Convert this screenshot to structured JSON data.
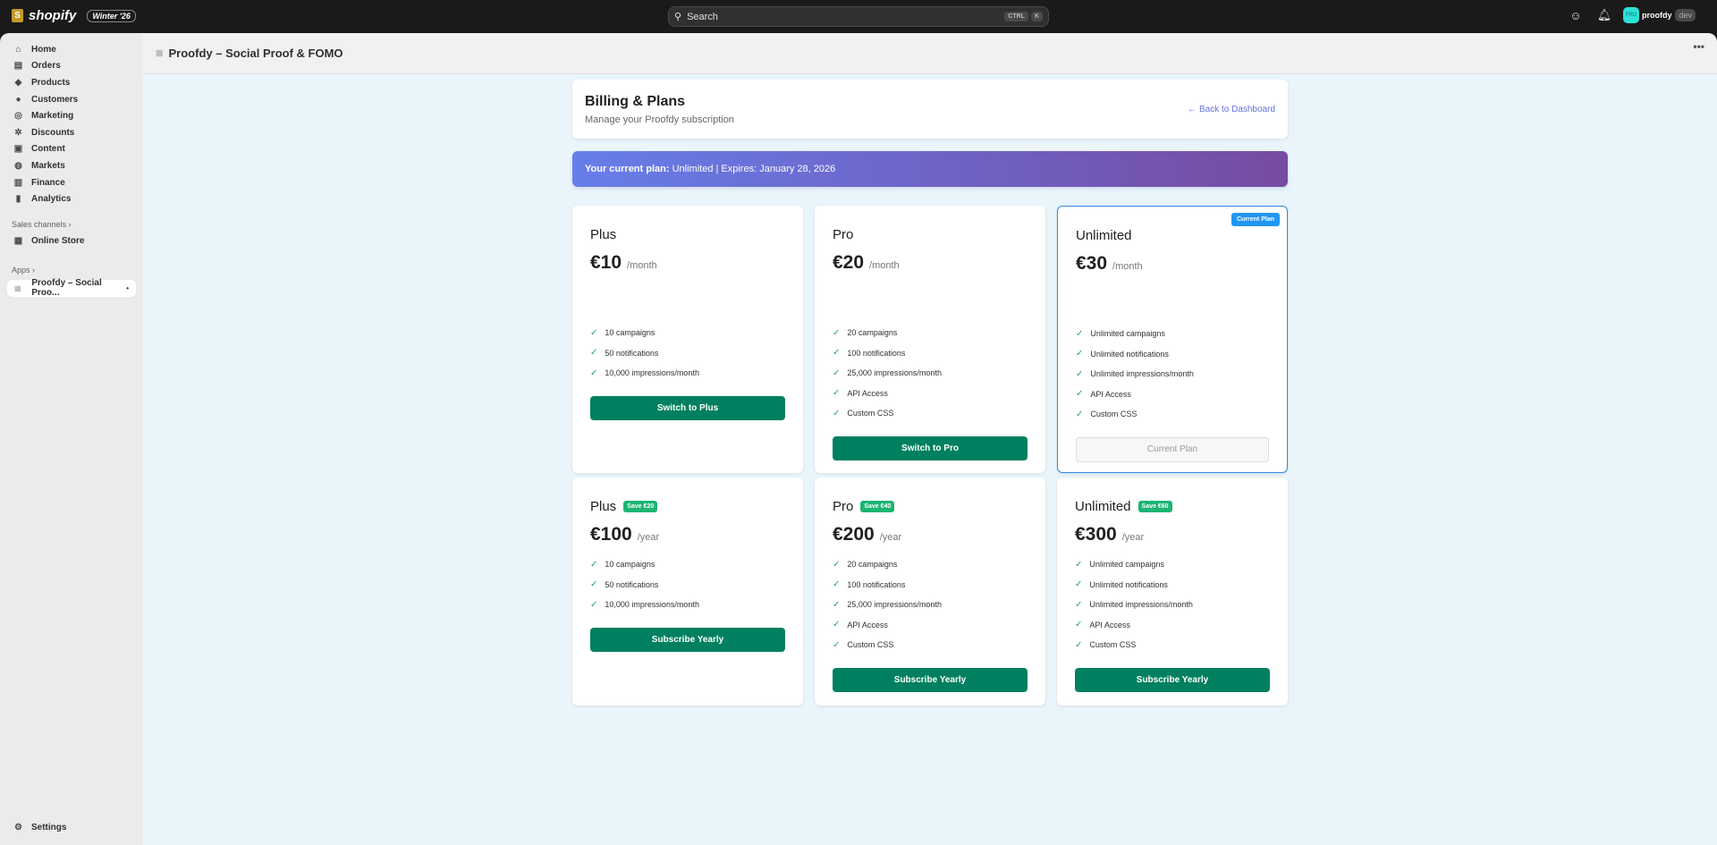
{
  "topbar": {
    "brand": "shopify",
    "edition": "Winter '26",
    "search_placeholder": "Search",
    "kbd1": "CTRL",
    "kbd2": "K",
    "avatar": "PRO",
    "store": "proofdy",
    "env": "dev"
  },
  "sidebar": {
    "items": [
      {
        "label": "Home",
        "icon": "⌂"
      },
      {
        "label": "Orders",
        "icon": "▤"
      },
      {
        "label": "Products",
        "icon": "◆"
      },
      {
        "label": "Customers",
        "icon": "●"
      },
      {
        "label": "Marketing",
        "icon": "◎"
      },
      {
        "label": "Discounts",
        "icon": "✲"
      },
      {
        "label": "Content",
        "icon": "▣"
      },
      {
        "label": "Markets",
        "icon": "◍"
      },
      {
        "label": "Finance",
        "icon": "▥"
      },
      {
        "label": "Analytics",
        "icon": "▮"
      }
    ],
    "sales_channels": "Sales channels ›",
    "online_store": "Online Store",
    "apps": "Apps ›",
    "app_item": "Proofdy – Social Proo...",
    "settings": "Settings"
  },
  "app_header": {
    "title": "Proofdy – Social Proof & FOMO"
  },
  "page": {
    "title": "Billing & Plans",
    "subtitle": "Manage your Proofdy subscription",
    "back": "← Back to Dashboard",
    "banner_label": "Your current plan:",
    "banner_value": " Unlimited | Expires: January 28, 2026"
  },
  "monthly": [
    {
      "name": "Plus",
      "price": "€10",
      "period": "/month",
      "features": [
        "10 campaigns",
        "50 notifications",
        "10,000 impressions/month"
      ],
      "button": "Switch to Plus"
    },
    {
      "name": "Pro",
      "price": "€20",
      "period": "/month",
      "features": [
        "20 campaigns",
        "100 notifications",
        "25,000 impressions/month",
        "API Access",
        "Custom CSS"
      ],
      "button": "Switch to Pro"
    },
    {
      "name": "Unlimited",
      "price": "€30",
      "period": "/month",
      "badge": "Current Plan",
      "features": [
        "Unlimited campaigns",
        "Unlimited notifications",
        "Unlimited impressions/month",
        "API Access",
        "Custom CSS"
      ],
      "button": "Current Plan"
    }
  ],
  "yearly": [
    {
      "name": "Plus",
      "save": "Save €20",
      "price": "€100",
      "period": "/year",
      "features": [
        "10 campaigns",
        "50 notifications",
        "10,000 impressions/month"
      ],
      "button": "Subscribe Yearly"
    },
    {
      "name": "Pro",
      "save": "Save €40",
      "price": "€200",
      "period": "/year",
      "features": [
        "20 campaigns",
        "100 notifications",
        "25,000 impressions/month",
        "API Access",
        "Custom CSS"
      ],
      "button": "Subscribe Yearly"
    },
    {
      "name": "Unlimited",
      "save": "Save €60",
      "price": "€300",
      "period": "/year",
      "features": [
        "Unlimited campaigns",
        "Unlimited notifications",
        "Unlimited impressions/month",
        "API Access",
        "Custom CSS"
      ],
      "button": "Subscribe Yearly"
    }
  ],
  "colors": {
    "accent": "#008060",
    "banner_start": "#667eea",
    "banner_end": "#764ba2",
    "current_border": "#2c8ce6"
  }
}
